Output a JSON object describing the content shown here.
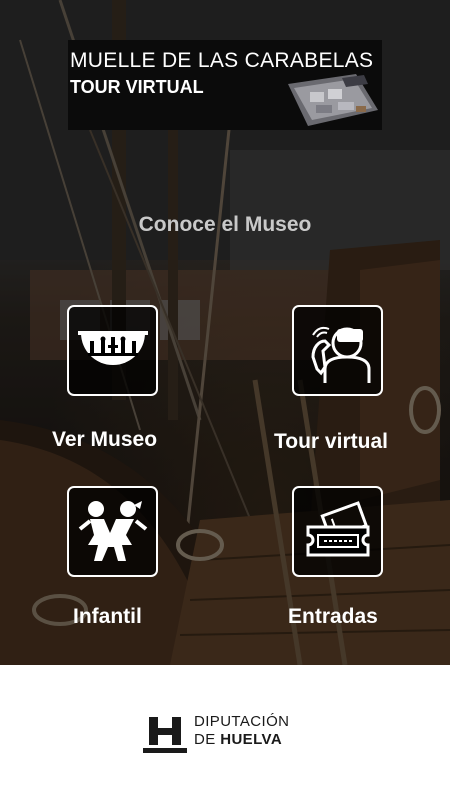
{
  "banner": {
    "title": "MUELLE DE LAS CARABELAS",
    "subtitle": "TOUR VIRTUAL"
  },
  "heading": "Conoce el Museo",
  "menu": [
    {
      "id": "ver-museo",
      "label": "Ver Museo",
      "icon": "museum-icon"
    },
    {
      "id": "tour-virtual",
      "label": "Tour virtual",
      "icon": "vr-headset-icon"
    },
    {
      "id": "infantil",
      "label": "Infantil",
      "icon": "children-icon"
    },
    {
      "id": "entradas",
      "label": "Entradas",
      "icon": "ticket-icon"
    }
  ],
  "footer": {
    "logo_line1": "DIPUTACIÓN",
    "logo_line2_prefix": "DE ",
    "logo_line2_bold": "HUELVA"
  },
  "colors": {
    "heading": "#c9c9c9",
    "tile_border": "#ffffff",
    "footer_bg": "#ffffff",
    "logo_text": "#1a1a1a"
  }
}
